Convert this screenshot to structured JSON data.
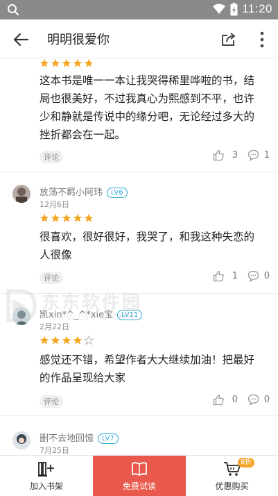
{
  "status_bar": {
    "time": "11:20"
  },
  "header": {
    "title": "明明很爱你"
  },
  "reviews": [
    {
      "user": "",
      "level": "",
      "date": "",
      "rating": 5,
      "text": "这本书是唯一一本让我哭得稀里哗啦的书，结局也很美好，不过我真心为熙感到不平，也许少和静就是传说中的缘分吧，无论经过多大的挫折都会在一起。",
      "tag": "评论",
      "likes": "3",
      "comments": "1"
    },
    {
      "user": "放荡不羁小阿玮",
      "level": "LV6",
      "date": "12月6日",
      "rating": 5,
      "text": "很喜欢，很好很好，我哭了，和我这种失恋的人很像",
      "tag": "评论",
      "likes": "1",
      "comments": "0"
    },
    {
      "user": "凯xin*^_^*xie宝",
      "level": "LV11",
      "date": "2月22日",
      "rating": 4,
      "text": "感觉还不错，希望作者大大继续加油！把最好的作品呈现给大家",
      "tag": "评论",
      "likes": "0",
      "comments": "0"
    },
    {
      "user": "删不去地回憶",
      "level": "LV7",
      "date": "7月25日",
      "rating": 0,
      "text": "",
      "tag": "",
      "likes": "",
      "comments": ""
    }
  ],
  "watermark": {
    "line1": "东东软件园",
    "line2": "WWW.ESOYU.COM"
  },
  "bottom_bar": {
    "shelf_label": "加入书架",
    "trial_label": "免费试读",
    "buy_label": "优惠购买",
    "buy_badge": "8折"
  },
  "colors": {
    "accent_red": "#e8584c",
    "star_orange": "#f5a623",
    "level_blue": "#2aa6d6",
    "badge_orange": "#f4a52a"
  }
}
